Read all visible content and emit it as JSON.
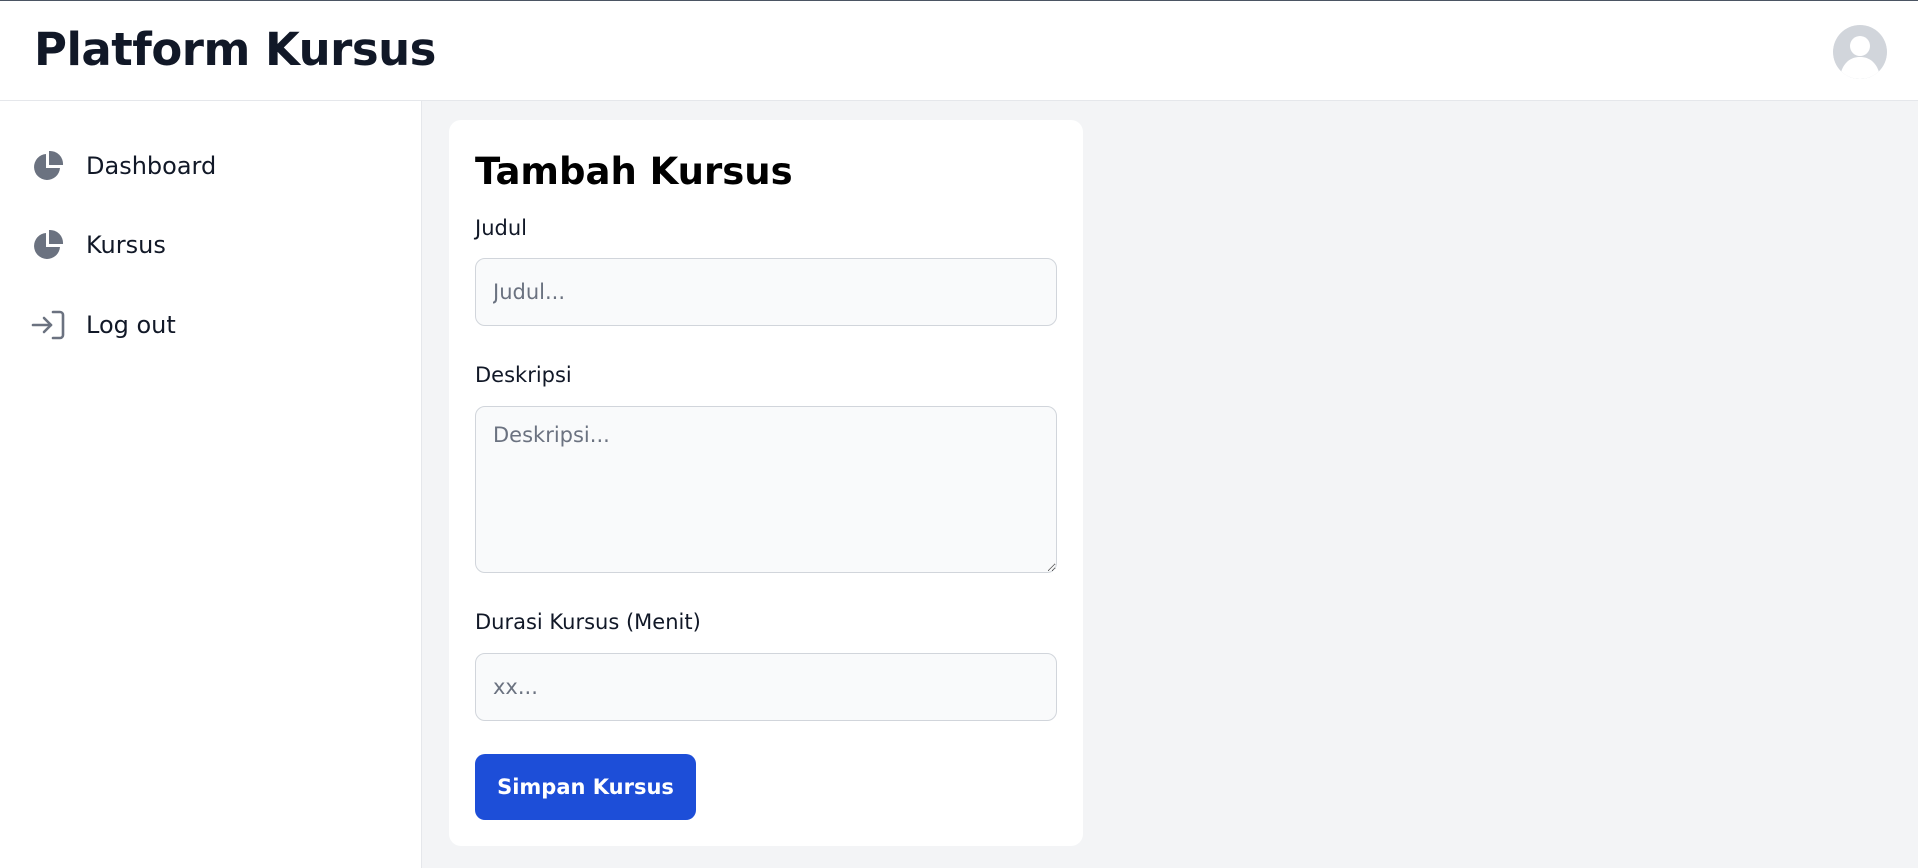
{
  "header": {
    "title": "Platform Kursus",
    "avatar_icon": "user-avatar-icon"
  },
  "sidebar": {
    "items": [
      {
        "label": "Dashboard",
        "icon": "pie-chart-icon"
      },
      {
        "label": "Kursus",
        "icon": "pie-chart-icon"
      },
      {
        "label": "Log out",
        "icon": "sign-in-arrow-icon"
      }
    ]
  },
  "form": {
    "title": "Tambah Kursus",
    "fields": [
      {
        "label": "Judul",
        "placeholder": "Judul...",
        "value": ""
      },
      {
        "label": "Deskripsi",
        "placeholder": "Deskripsi...",
        "value": ""
      },
      {
        "label": "Durasi Kursus (Menit)",
        "placeholder": "xx...",
        "value": ""
      }
    ],
    "submit_label": "Simpan Kursus"
  },
  "colors": {
    "primary": "#1d4ed8",
    "background": "#f3f4f6",
    "surface": "#ffffff",
    "icon": "#6b7280",
    "text": "#111827"
  }
}
